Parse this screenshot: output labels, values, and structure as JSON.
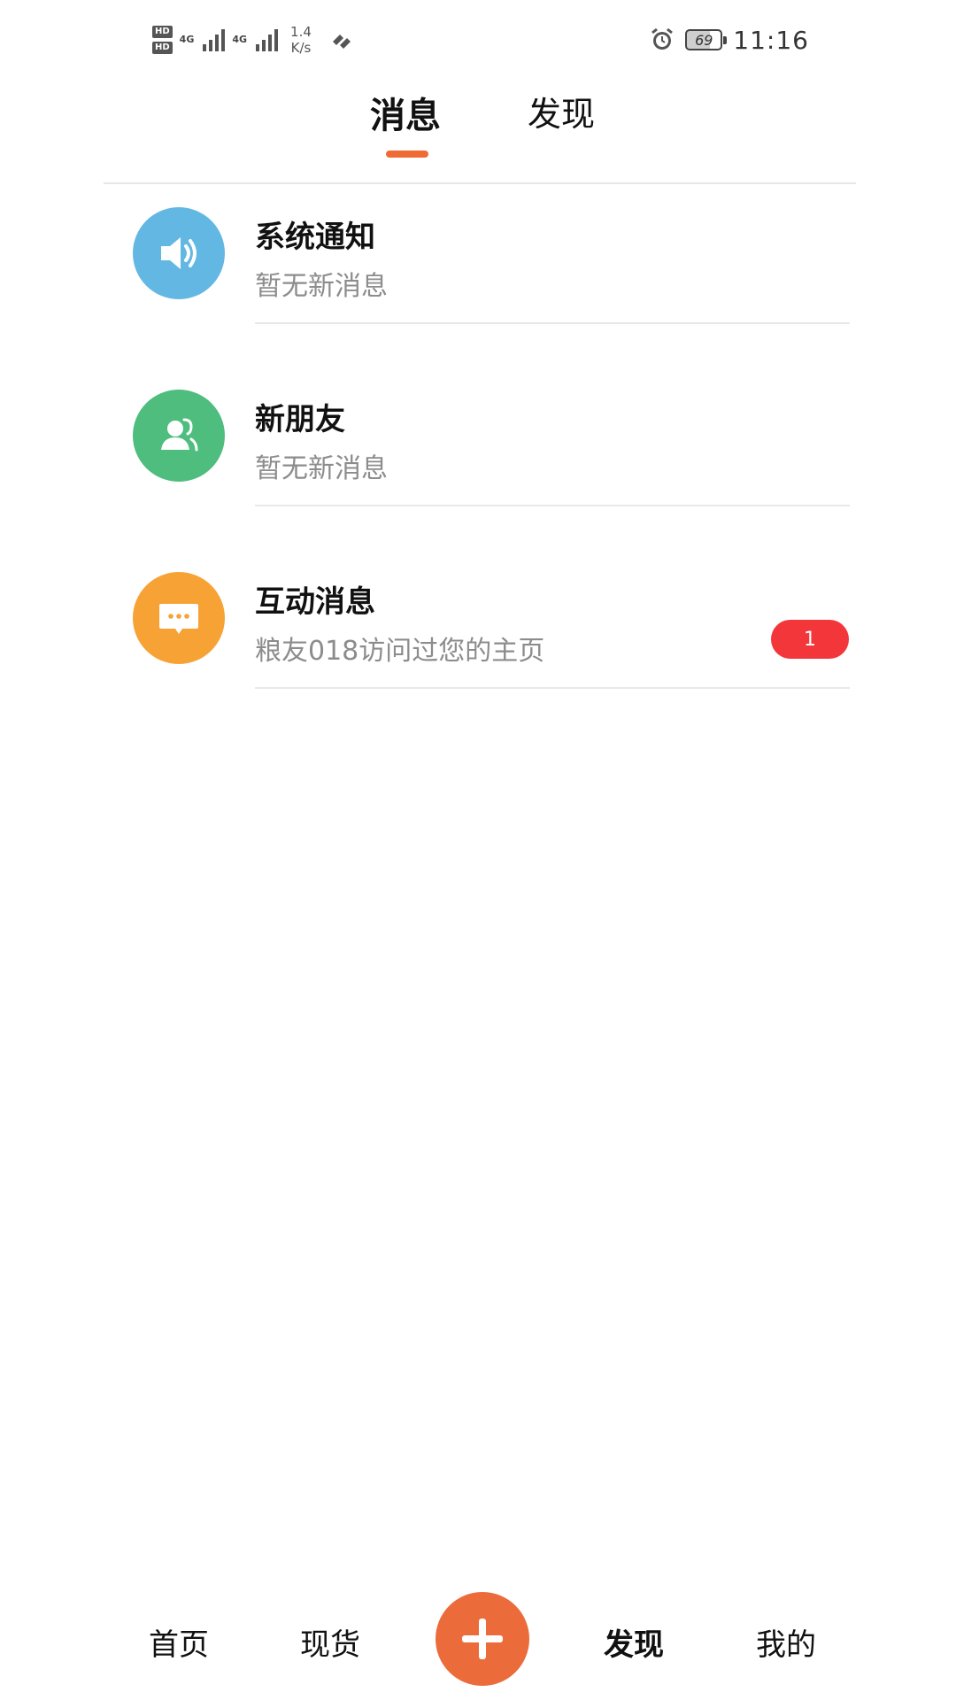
{
  "status_bar": {
    "hd_1": "HD",
    "hd_2": "HD",
    "net_1": "4G",
    "net_2": "4G",
    "speed_value": "1.4",
    "speed_unit": "K/s",
    "battery": "69",
    "time": "11:16"
  },
  "tabs": {
    "messages": "消息",
    "discover": "发现"
  },
  "messages": [
    {
      "title": "系统通知",
      "subtitle": "暂无新消息",
      "icon": "speaker-icon",
      "color": "#63b8e3"
    },
    {
      "title": "新朋友",
      "subtitle": "暂无新消息",
      "icon": "friends-icon",
      "color": "#4ebd7d"
    },
    {
      "title": "互动消息",
      "subtitle": "粮友018访问过您的主页",
      "icon": "chat-icon",
      "color": "#f7a235",
      "badge": "1"
    }
  ],
  "bottom_nav": {
    "home": "首页",
    "stock": "现货",
    "discover": "发现",
    "mine": "我的"
  },
  "colors": {
    "accent": "#f06a33",
    "badge": "#f2363a"
  }
}
